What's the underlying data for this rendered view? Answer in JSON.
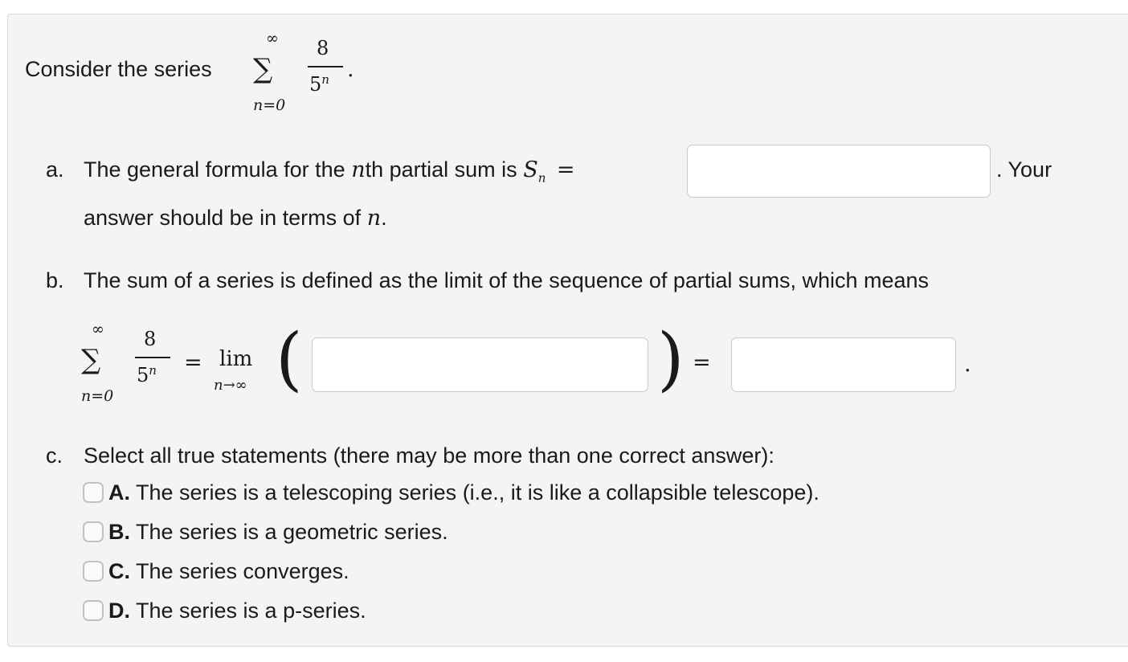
{
  "intro": {
    "text": "Consider the series",
    "sum_upper": "∞",
    "sum_lower": "n=0",
    "numerator": "8",
    "denominator_base": "5",
    "denominator_exp": "n",
    "period": "."
  },
  "part_a": {
    "label": "a.",
    "text_before": "The general formula for the",
    "n_var": "n",
    "text_th": "th partial sum is",
    "s_var": "S",
    "s_sub": "n",
    "equals": "=",
    "after_input": ". Your",
    "line2": "answer should be in terms of",
    "line2_var": "n",
    "line2_end": ".",
    "input_value": ""
  },
  "part_b": {
    "label": "b.",
    "text": "The sum of a series is defined as the limit of the sequence of partial sums, which means",
    "sum_upper": "∞",
    "sum_lower": "n=0",
    "numerator": "8",
    "denominator_base": "5",
    "denominator_exp": "n",
    "equals1": "=",
    "lim": "lim",
    "lim_sub": "n→∞",
    "left_paren": "(",
    "right_paren": ")",
    "equals2": "=",
    "period": ".",
    "input1_value": "",
    "input2_value": ""
  },
  "part_c": {
    "label": "c.",
    "prompt": "Select all true statements (there may be more than one correct answer):",
    "options": [
      {
        "letter": "A.",
        "text": "The series is a telescoping series (i.e., it is like a collapsible telescope).",
        "checked": false
      },
      {
        "letter": "B.",
        "text": "The series is a geometric series.",
        "checked": false
      },
      {
        "letter": "C.",
        "text": "The series converges.",
        "checked": false
      },
      {
        "letter": "D.",
        "text": "The series is a p-series.",
        "checked": false
      }
    ]
  }
}
